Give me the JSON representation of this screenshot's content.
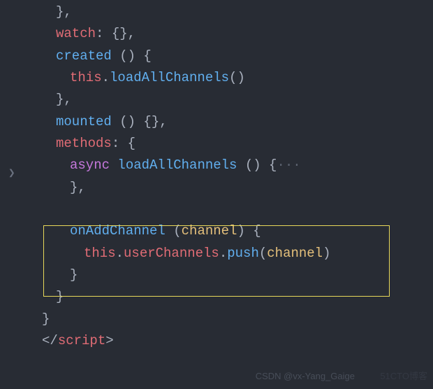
{
  "code": {
    "line1_close": "},",
    "watch": "watch",
    "watch_val": ": {},",
    "created": "created",
    "created_parens": " () {",
    "this": "this",
    "dot": ".",
    "loadAllChannels": "loadAllChannels",
    "call_parens": "()",
    "close_brace_comma": "},",
    "mounted": "mounted",
    "mounted_val": " () {},",
    "methods": "methods",
    "methods_open": ": {",
    "async": "async",
    "space": " ",
    "load_fn": "loadAllChannels",
    "load_parens": " () {",
    "fold_dots": "···",
    "onAddChannel": "onAddChannel",
    "open_paren": " (",
    "channel": "channel",
    "close_paren_brace": ") {",
    "userChannels": "userChannels",
    "push": "push",
    "push_open": "(",
    "push_close": ")",
    "close_brace": "}",
    "script_open": "</",
    "script_tag": "script",
    "script_close": ">"
  },
  "watermarks": {
    "csdn": "CSDN @vx-Yang_Gaige",
    "cto": "51CTO博客"
  },
  "fold_arrow": "❯"
}
